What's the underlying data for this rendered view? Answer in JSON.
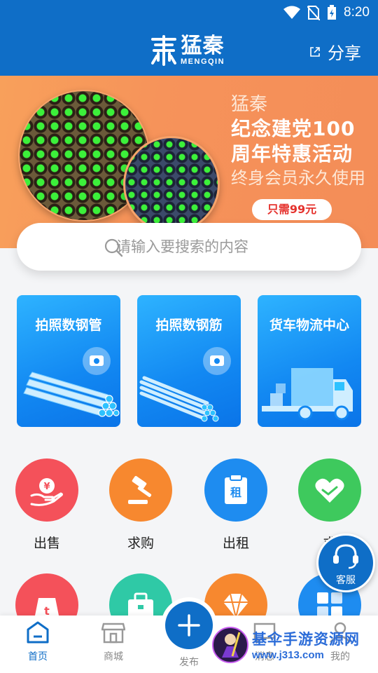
{
  "status_bar": {
    "time": "8:20"
  },
  "header": {
    "logo_cn": "猛秦",
    "logo_en": "MENGQIN",
    "share_label": "分享"
  },
  "banner": {
    "brand": "猛秦",
    "line1": "纪念建党100",
    "line2": "周年特惠活动",
    "line3": "终身会员永久使用",
    "price_tag": "只需99元"
  },
  "search": {
    "placeholder": "请输入要搜索的内容"
  },
  "feature_cards": [
    {
      "title": "拍照数钢管",
      "icon": "camera-icon"
    },
    {
      "title": "拍照数钢筋",
      "icon": "camera-icon"
    },
    {
      "title": "货车物流中心",
      "icon": "truck-icon"
    }
  ],
  "grid": [
    {
      "label": "出售",
      "icon": "yuan-hand-icon",
      "color": "#f4515a"
    },
    {
      "label": "求购",
      "icon": "gavel-icon",
      "color": "#f7882f"
    },
    {
      "label": "出租",
      "icon": "clipboard-rent-icon",
      "color": "#1e8cf0"
    },
    {
      "label": "求",
      "icon": "heart-handshake-icon",
      "color": "#3ec95d"
    },
    {
      "label": "",
      "icon": "weight-icon",
      "color": "#f4515a"
    },
    {
      "label": "",
      "icon": "toolbox-icon",
      "color": "#2fc9a6"
    },
    {
      "label": "",
      "icon": "diamond-icon",
      "color": "#f7882f"
    },
    {
      "label": "",
      "icon": "blocks-icon",
      "color": "#1e8cf0"
    }
  ],
  "customer_service": {
    "label": "客服"
  },
  "tabbar": {
    "home": "首页",
    "mall": "商城",
    "publish": "发布",
    "messages": "消息",
    "mine": "我的"
  },
  "watermark": {
    "title": "基伞手游资源网",
    "url": "www.j313.com"
  },
  "colors": {
    "primary": "#0f6ec7",
    "banner": "#f6935a"
  }
}
